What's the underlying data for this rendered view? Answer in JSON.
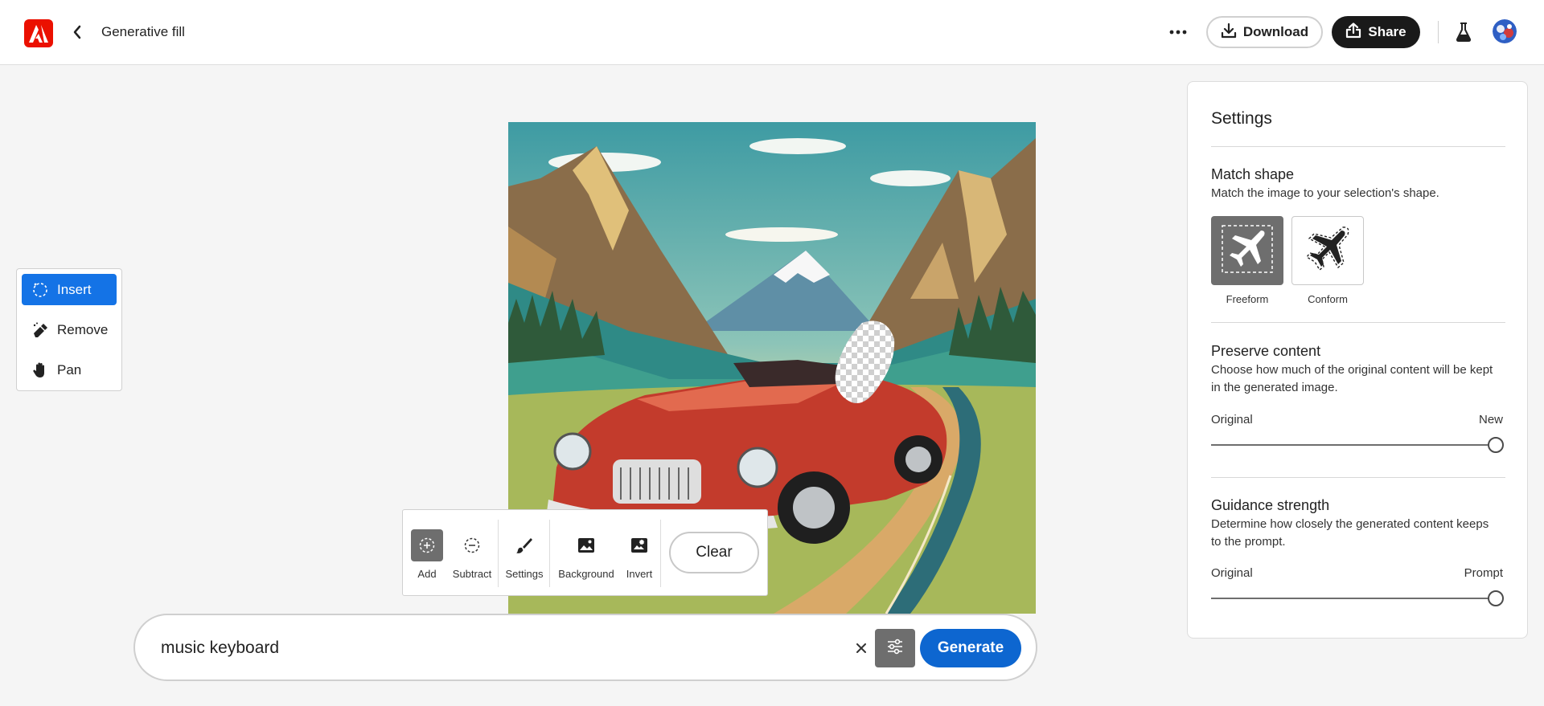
{
  "app": {
    "title": "Generative fill",
    "download_label": "Download",
    "share_label": "Share",
    "logo_color": "#eb1000"
  },
  "tools": [
    {
      "label": "Insert",
      "icon": "insert-icon",
      "active": true
    },
    {
      "label": "Remove",
      "icon": "eraser-icon",
      "active": false
    },
    {
      "label": "Pan",
      "icon": "hand-icon",
      "active": false
    }
  ],
  "selection_toolbar": {
    "add_label": "Add",
    "subtract_label": "Subtract",
    "settings_label": "Settings",
    "background_label": "Background",
    "invert_label": "Invert",
    "clear_label": "Clear"
  },
  "prompt": {
    "value": "music keyboard",
    "generate_label": "Generate"
  },
  "settings_panel": {
    "title": "Settings",
    "match_shape": {
      "title": "Match shape",
      "description": "Match the image to your selection's shape.",
      "options": [
        "Freeform",
        "Conform"
      ],
      "selected": "Freeform"
    },
    "preserve_content": {
      "title": "Preserve content",
      "description": "Choose how much of the original content will be kept in the generated image.",
      "min_label": "Original",
      "max_label": "New",
      "value": 1.0
    },
    "guidance_strength": {
      "title": "Guidance strength",
      "description": "Determine how closely the generated content keeps to the prompt.",
      "min_label": "Original",
      "max_label": "Prompt",
      "value": 1.0
    }
  },
  "colors": {
    "accent_blue": "#1473e6",
    "generate_blue": "#0d66d0",
    "dark_button": "#1a1a1a"
  }
}
